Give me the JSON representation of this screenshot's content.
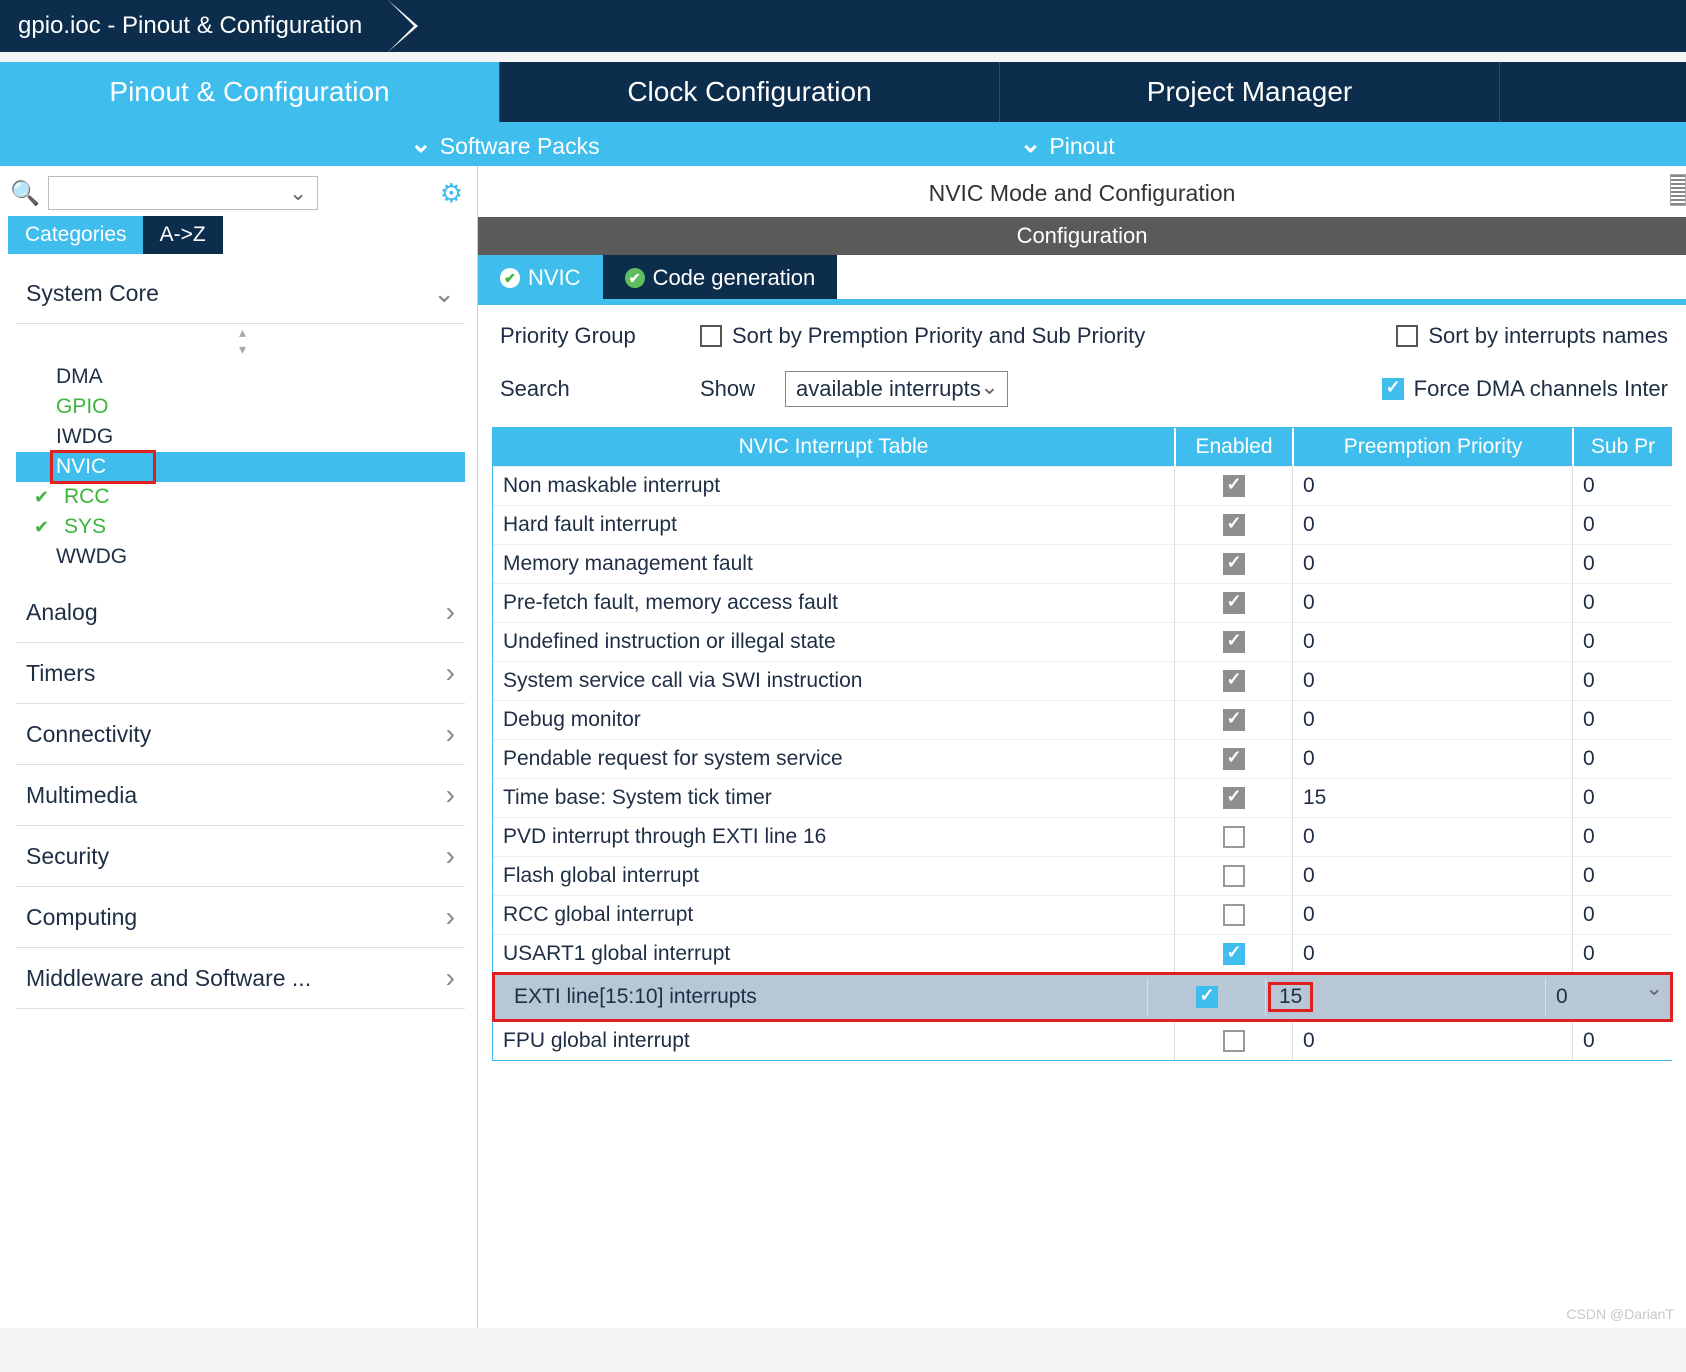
{
  "breadcrumb": "gpio.ioc - Pinout & Configuration",
  "main_tabs": {
    "pinout": "Pinout & Configuration",
    "clock": "Clock Configuration",
    "project": "Project Manager"
  },
  "sub_bar": {
    "packs": "Software Packs",
    "pinout": "Pinout"
  },
  "left": {
    "view_tabs": {
      "cat": "Categories",
      "az": "A->Z"
    },
    "groups": {
      "system_core": {
        "label": "System Core",
        "items": {
          "dma": {
            "label": "DMA"
          },
          "gpio": {
            "label": "GPIO"
          },
          "iwdg": {
            "label": "IWDG"
          },
          "nvic": {
            "label": "NVIC"
          },
          "rcc": {
            "label": "RCC"
          },
          "sys": {
            "label": "SYS"
          },
          "wwdg": {
            "label": "WWDG"
          }
        }
      },
      "analog": {
        "label": "Analog"
      },
      "timers": {
        "label": "Timers"
      },
      "connectivity": {
        "label": "Connectivity"
      },
      "multimedia": {
        "label": "Multimedia"
      },
      "security": {
        "label": "Security"
      },
      "computing": {
        "label": "Computing"
      },
      "middleware": {
        "label": "Middleware and Software ..."
      }
    }
  },
  "right": {
    "title": "NVIC Mode and Configuration",
    "conf_label": "Configuration",
    "inner_tabs": {
      "nvic": "NVIC",
      "codegen": "Code generation"
    },
    "opts": {
      "priority_group": "Priority Group",
      "sort_preempt": "Sort by Premption Priority and Sub Priority",
      "sort_name": "Sort by interrupts names",
      "search": "Search",
      "show": "Show",
      "show_value": "available interrupts",
      "force_dma": "Force DMA channels Inter"
    },
    "table": {
      "headers": {
        "name": "NVIC Interrupt Table",
        "enabled": "Enabled",
        "preempt": "Preemption Priority",
        "sub": "Sub Pr"
      },
      "rows": [
        {
          "name": "Non maskable interrupt",
          "en": "grey",
          "pre": "0",
          "sub": "0"
        },
        {
          "name": "Hard fault interrupt",
          "en": "grey",
          "pre": "0",
          "sub": "0"
        },
        {
          "name": "Memory management fault",
          "en": "grey",
          "pre": "0",
          "sub": "0"
        },
        {
          "name": "Pre-fetch fault, memory access fault",
          "en": "grey",
          "pre": "0",
          "sub": "0"
        },
        {
          "name": "Undefined instruction or illegal state",
          "en": "grey",
          "pre": "0",
          "sub": "0"
        },
        {
          "name": "System service call via SWI instruction",
          "en": "grey",
          "pre": "0",
          "sub": "0"
        },
        {
          "name": "Debug monitor",
          "en": "grey",
          "pre": "0",
          "sub": "0"
        },
        {
          "name": "Pendable request for system service",
          "en": "grey",
          "pre": "0",
          "sub": "0"
        },
        {
          "name": "Time base: System tick timer",
          "en": "grey",
          "pre": "15",
          "sub": "0"
        },
        {
          "name": "PVD interrupt through EXTI line 16",
          "en": "off",
          "pre": "0",
          "sub": "0"
        },
        {
          "name": "Flash global interrupt",
          "en": "off",
          "pre": "0",
          "sub": "0"
        },
        {
          "name": "RCC global interrupt",
          "en": "off",
          "pre": "0",
          "sub": "0"
        },
        {
          "name": "USART1 global interrupt",
          "en": "blue",
          "pre": "0",
          "sub": "0"
        },
        {
          "name": "EXTI line[15:10] interrupts",
          "en": "blue",
          "pre": "15",
          "sub": "0",
          "sel": true,
          "hl": true,
          "pre_box": true
        },
        {
          "name": "FPU global interrupt",
          "en": "off",
          "pre": "0",
          "sub": "0"
        }
      ]
    }
  },
  "watermark": "CSDN @DarianT"
}
